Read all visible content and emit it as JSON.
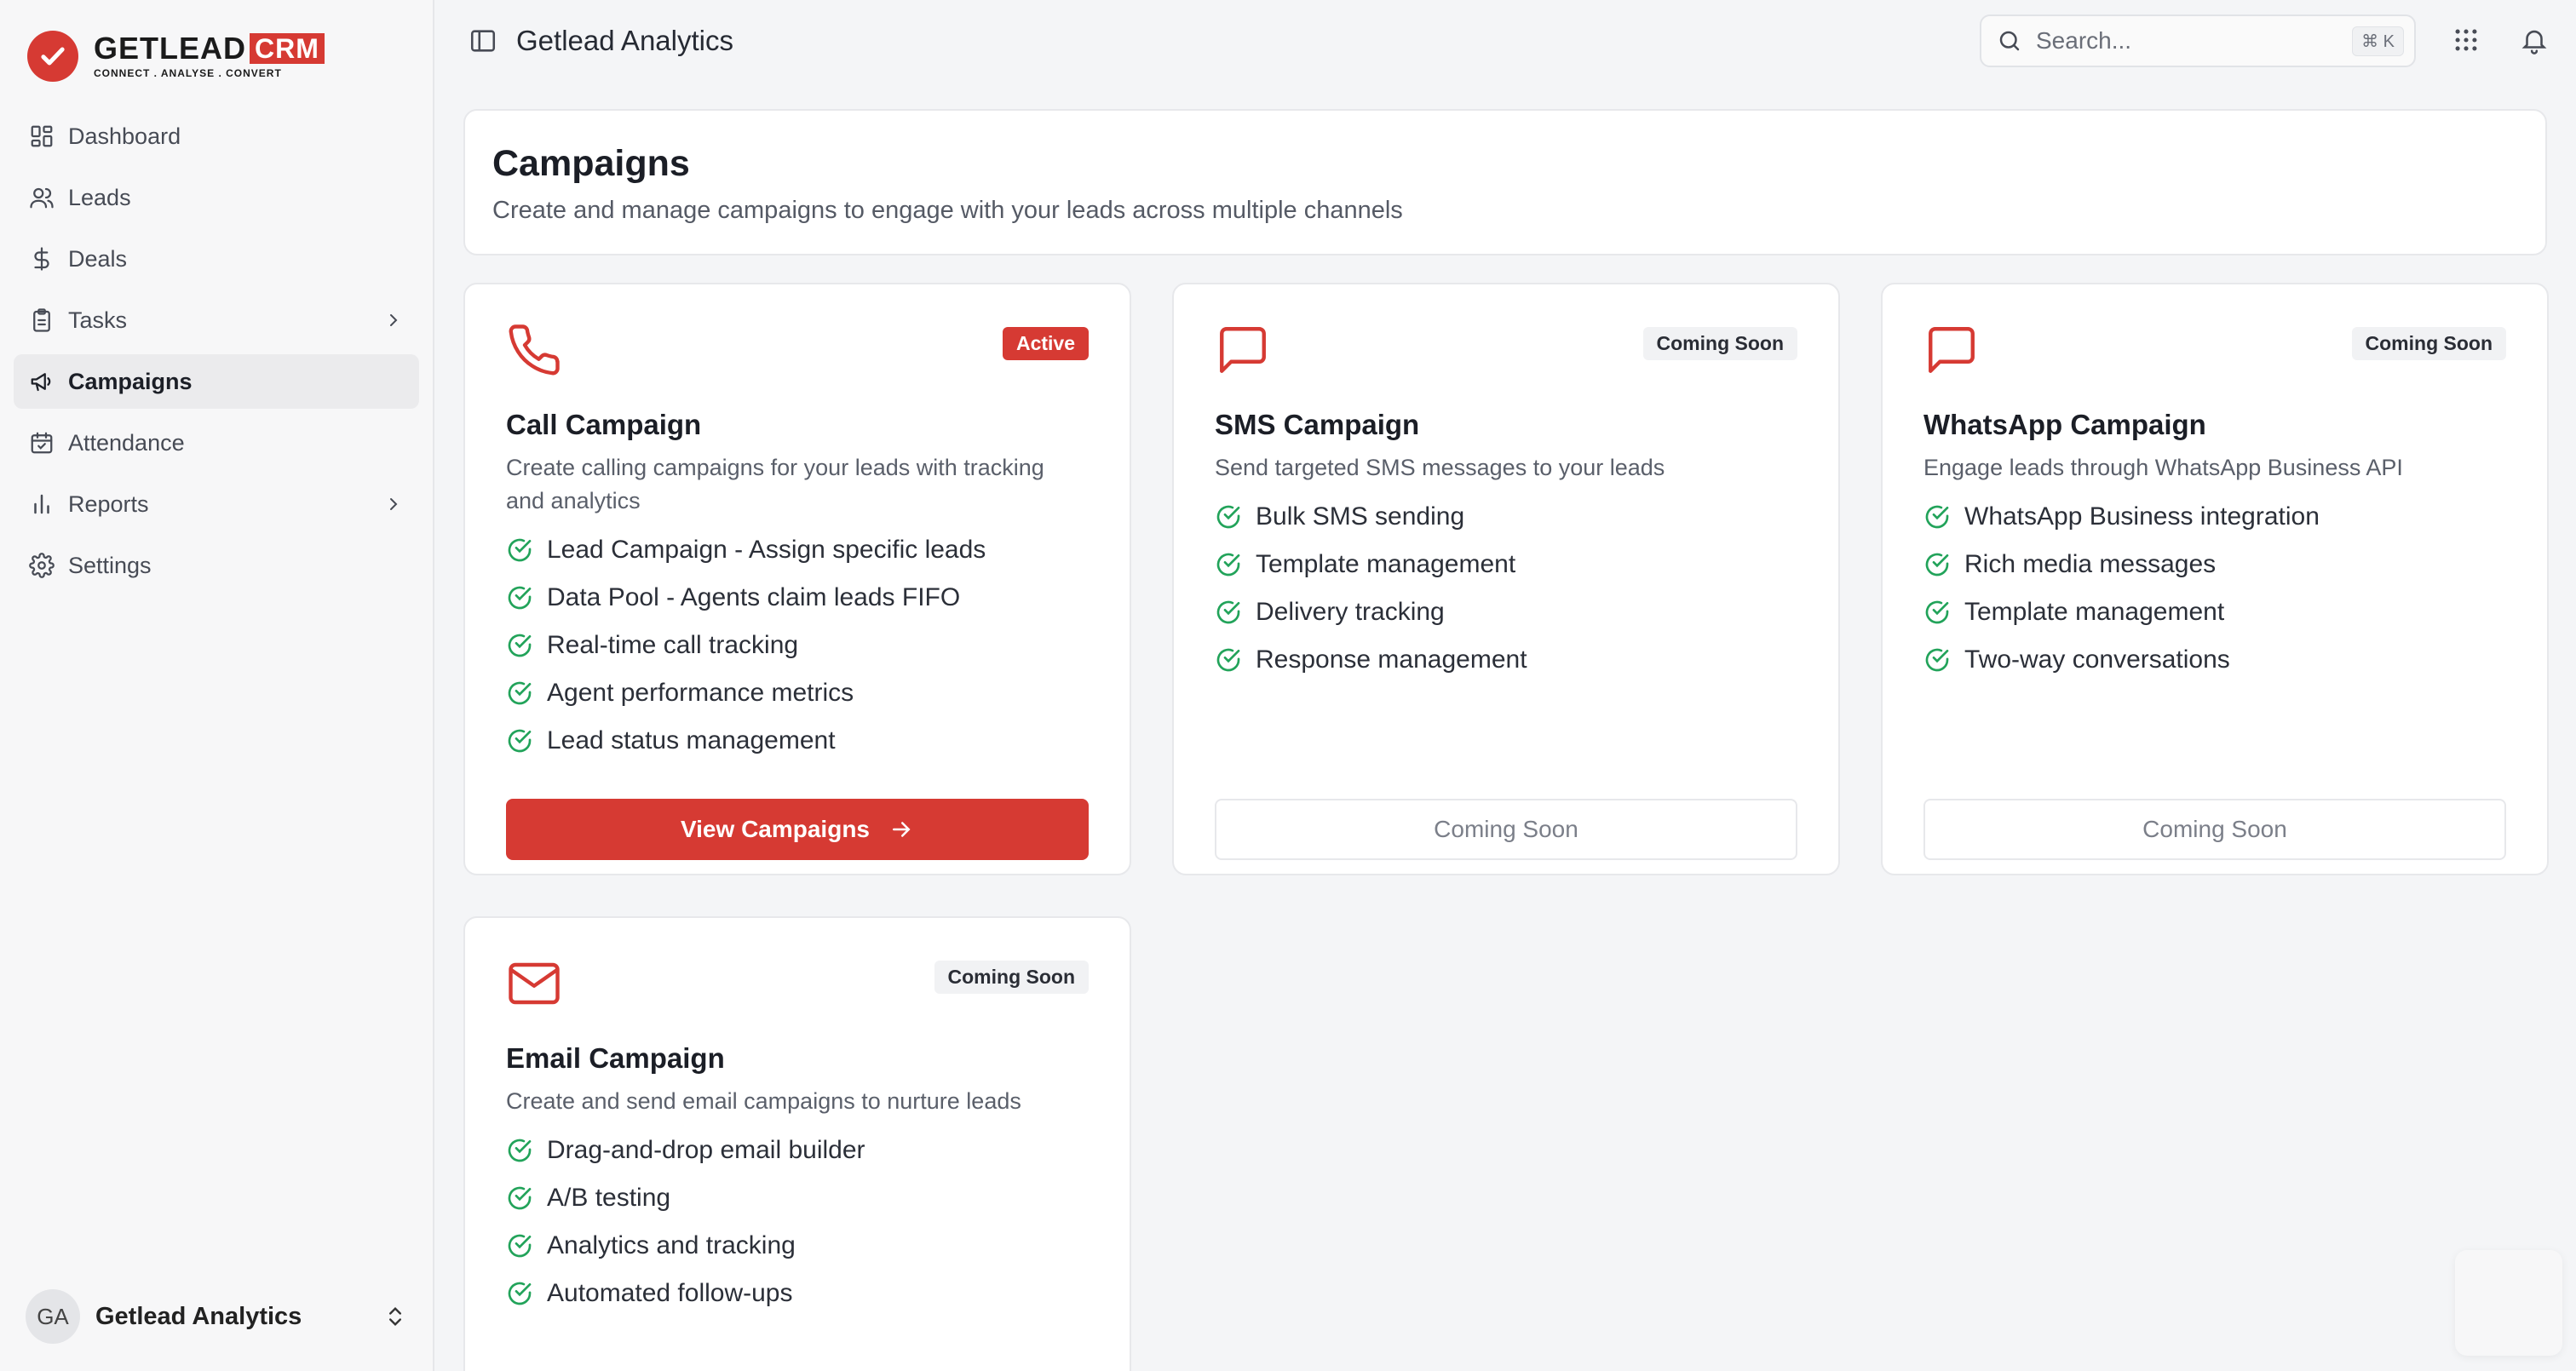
{
  "app": {
    "logo_word": "GETLEAD",
    "logo_crm": "CRM",
    "logo_tagline": "CONNECT . ANALYSE . CONVERT"
  },
  "sidebar": {
    "items": [
      {
        "label": "Dashboard",
        "icon": "dashboard-grid-icon"
      },
      {
        "label": "Leads",
        "icon": "users-icon"
      },
      {
        "label": "Deals",
        "icon": "dollar-icon"
      },
      {
        "label": "Tasks",
        "icon": "clipboard-icon",
        "has_children": true
      },
      {
        "label": "Campaigns",
        "icon": "megaphone-icon",
        "active": true
      },
      {
        "label": "Attendance",
        "icon": "calendar-check-icon"
      },
      {
        "label": "Reports",
        "icon": "bar-chart-icon",
        "has_children": true
      },
      {
        "label": "Settings",
        "icon": "gear-icon"
      }
    ],
    "user": {
      "initials": "GA",
      "name": "Getlead Analytics"
    }
  },
  "topbar": {
    "title": "Getlead Analytics",
    "search_placeholder": "Search...",
    "search_shortcut": "⌘ K"
  },
  "header": {
    "title": "Campaigns",
    "subtitle": "Create and manage campaigns to engage with your leads across multiple channels"
  },
  "cards": [
    {
      "icon": "phone-icon",
      "badge": "Active",
      "title": "Call Campaign",
      "desc": "Create calling campaigns for your leads with tracking and analytics",
      "features": [
        "Lead Campaign - Assign specific leads",
        "Data Pool - Agents claim leads FIFO",
        "Real-time call tracking",
        "Agent performance metrics",
        "Lead status management"
      ],
      "button": "View Campaigns"
    },
    {
      "icon": "message-icon",
      "badge": "Coming Soon",
      "title": "SMS Campaign",
      "desc": "Send targeted SMS messages to your leads",
      "features": [
        "Bulk SMS sending",
        "Template management",
        "Delivery tracking",
        "Response management"
      ],
      "button": "Coming Soon"
    },
    {
      "icon": "message-icon",
      "badge": "Coming Soon",
      "title": "WhatsApp Campaign",
      "desc": "Engage leads through WhatsApp Business API",
      "features": [
        "WhatsApp Business integration",
        "Rich media messages",
        "Template management",
        "Two-way conversations"
      ],
      "button": "Coming Soon"
    },
    {
      "icon": "mail-icon",
      "badge": "Coming Soon",
      "title": "Email Campaign",
      "desc": "Create and send email campaigns to nurture leads",
      "features": [
        "Drag-and-drop email builder",
        "A/B testing",
        "Analytics and tracking",
        "Automated follow-ups"
      ]
    }
  ],
  "colors": {
    "accent": "#d63a33",
    "success": "#22a35a",
    "text": "#1f2430",
    "muted": "#5a5f6a"
  }
}
